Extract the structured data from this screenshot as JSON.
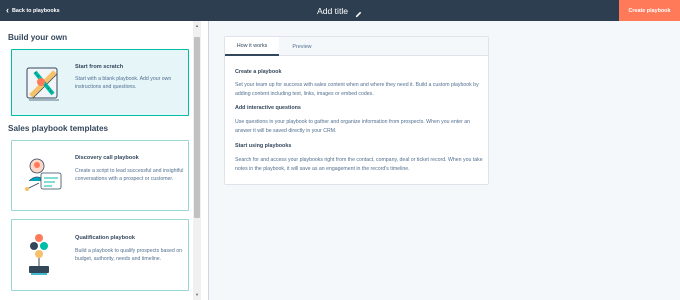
{
  "header": {
    "back_label": "Back to playbooks",
    "title": "Add title",
    "create_label": "Create playbook"
  },
  "left": {
    "section1": "Build your own",
    "section2": "Sales playbook templates",
    "cards": [
      {
        "title": "Start from scratch",
        "desc": "Start with a blank playbook. Add your own instructions and questions.",
        "icon": "pencil-ruler-icon"
      },
      {
        "title": "Discovery call playbook",
        "desc": "Create a script to lead successful and insightful conversations with a prospect or customer.",
        "icon": "discovery-call-icon"
      },
      {
        "title": "Qualification playbook",
        "desc": "Build a playbook to qualify prospects based on budget, authority, needs and timeline.",
        "icon": "qualification-icon"
      }
    ]
  },
  "info": {
    "tabs": [
      "How it works",
      "Preview"
    ],
    "sections": [
      {
        "heading": "Create a playbook",
        "text": "Set your team up for success with sales content when and where they need it. Build a custom playbook by adding content including text, links, images or embed codes."
      },
      {
        "heading": "Add interactive questions",
        "text": "Use questions in your playbook to gather and organize information from prospects. When you enter an answer it will be saved directly in your CRM."
      },
      {
        "heading": "Start using playbooks",
        "text": "Search for and access your playbooks right from the contact, company, deal or ticket record. When you take notes in the playbook, it will save as an engagement in the record's timeline."
      }
    ]
  },
  "colors": {
    "topbar": "#2d3e50",
    "accent": "#ff7a59",
    "teal": "#00bda5"
  }
}
